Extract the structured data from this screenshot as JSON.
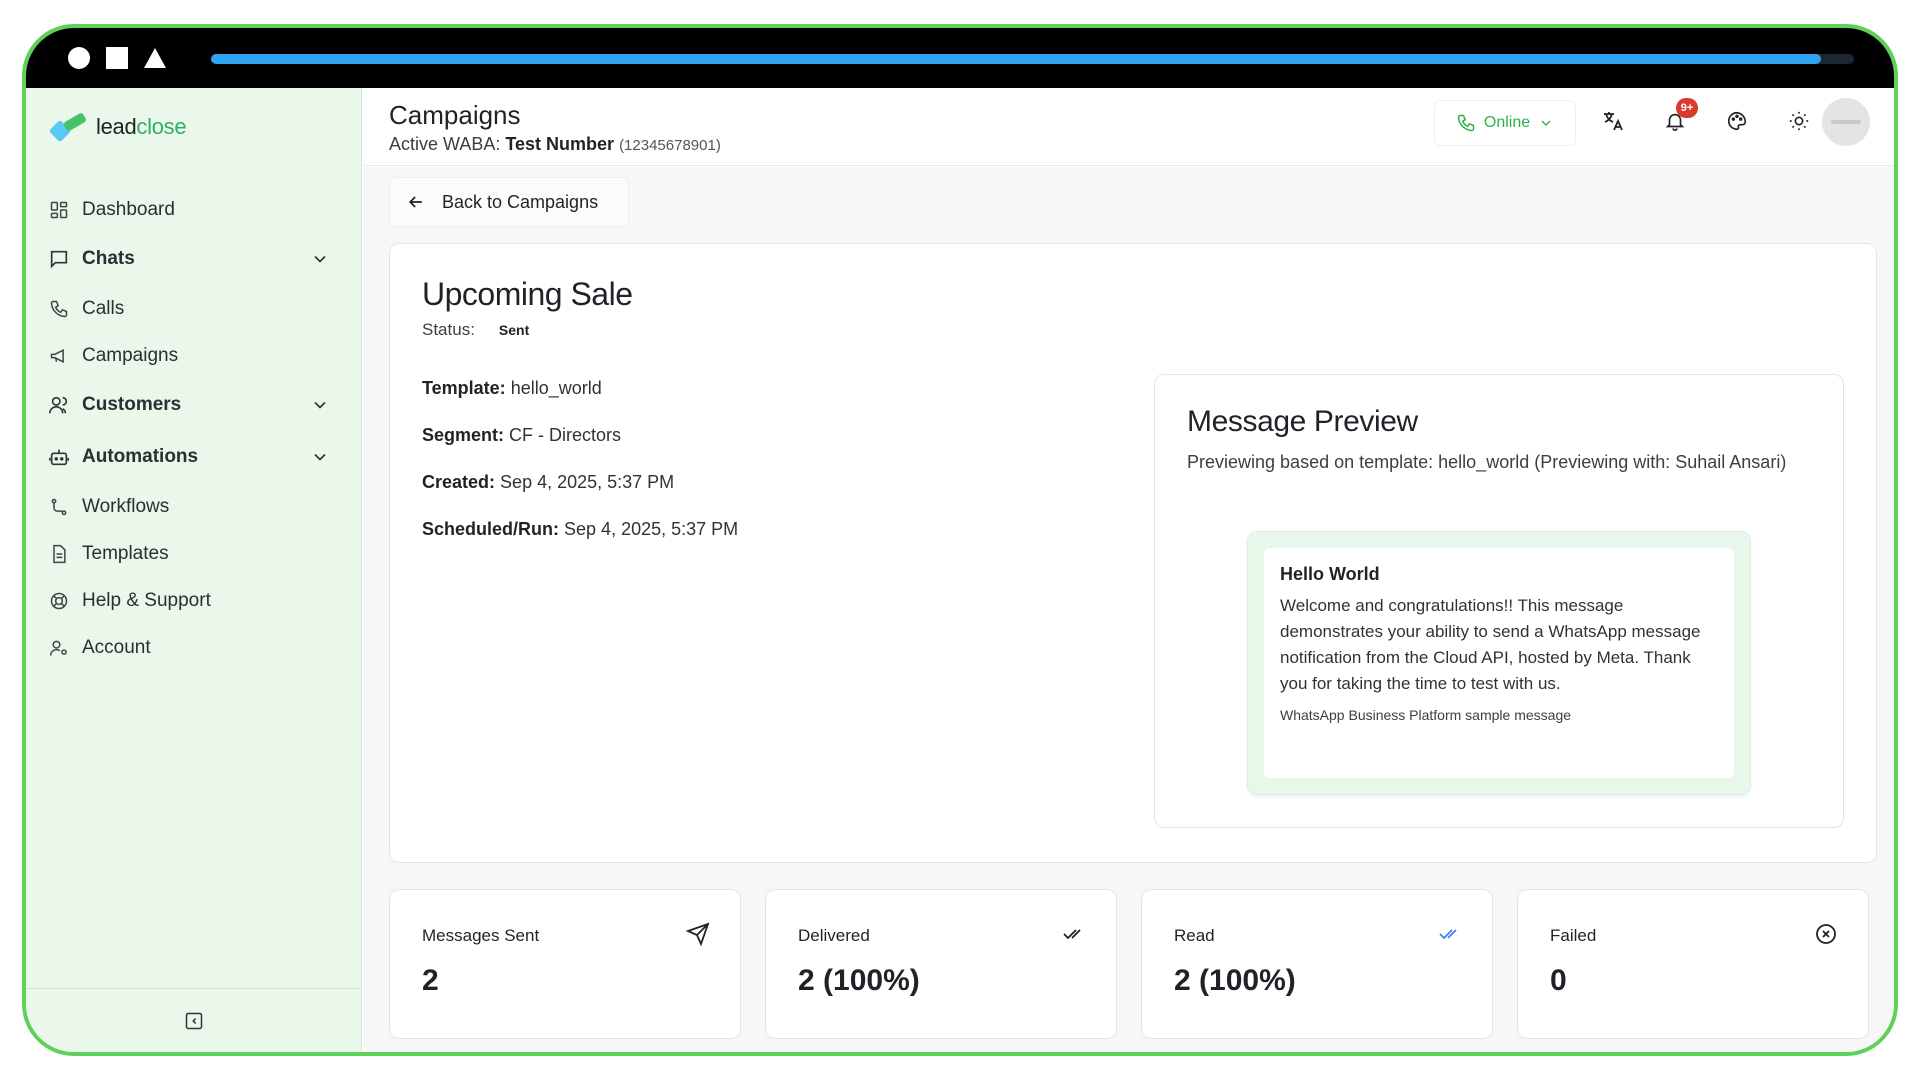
{
  "window": {
    "progress": 0.98
  },
  "sidebar": {
    "logo": {
      "prefix": "lead",
      "suffix": "close"
    },
    "items": [
      {
        "label": "Dashboard",
        "icon": "dashboard-icon",
        "group": false
      },
      {
        "label": "Chats",
        "icon": "chat-icon",
        "group": true
      },
      {
        "label": "Calls",
        "icon": "phone-icon",
        "group": false
      },
      {
        "label": "Campaigns",
        "icon": "megaphone-icon",
        "group": false
      },
      {
        "label": "Customers",
        "icon": "users-icon",
        "group": true
      },
      {
        "label": "Automations",
        "icon": "bot-icon",
        "group": true
      },
      {
        "label": "Workflows",
        "icon": "workflow-icon",
        "group": false
      },
      {
        "label": "Templates",
        "icon": "file-icon",
        "group": false
      },
      {
        "label": "Help & Support",
        "icon": "lifebuoy-icon",
        "group": false
      },
      {
        "label": "Account",
        "icon": "user-key-icon",
        "group": false
      }
    ]
  },
  "header": {
    "title": "Campaigns",
    "waba_prefix": "Active WABA: ",
    "waba_name": "Test Number",
    "waba_number": "(12345678901)",
    "status_label": "Online",
    "notifications_badge": "9+"
  },
  "main": {
    "back_label": "Back to Campaigns",
    "campaign": {
      "name": "Upcoming Sale",
      "status_label": "Status:",
      "status_value": "Sent",
      "details": [
        {
          "key": "Template:",
          "value": "hello_world"
        },
        {
          "key": "Segment:",
          "value": "CF - Directors"
        },
        {
          "key": "Created:",
          "value": "Sep 4, 2025, 5:37 PM"
        },
        {
          "key": "Scheduled/Run:",
          "value": "Sep 4, 2025, 5:37 PM"
        }
      ]
    },
    "preview": {
      "title": "Message Preview",
      "subtitle": "Previewing based on template: hello_world (Previewing with: Suhail Ansari)",
      "message_title": "Hello World",
      "message_body": "Welcome and congratulations!! This message demonstrates your ability to send a WhatsApp message notification from the Cloud API, hosted by Meta. Thank you for taking the time to test with us.",
      "message_footer": "WhatsApp Business Platform sample message"
    },
    "stats": [
      {
        "label": "Messages Sent",
        "value": "2",
        "icon": "send-icon"
      },
      {
        "label": "Delivered",
        "value": "2 (100%)",
        "icon": "double-check-icon"
      },
      {
        "label": "Read",
        "value": "2 (100%)",
        "icon": "double-check-blue-icon"
      },
      {
        "label": "Failed",
        "value": "0",
        "icon": "x-circle-icon"
      }
    ]
  },
  "colors": {
    "accent": "#2fb04a",
    "sidebar_bg": "#e9f8ea",
    "frame": "#5fd05a",
    "read_blue": "#3b82f6",
    "badge": "#d83b2c"
  }
}
